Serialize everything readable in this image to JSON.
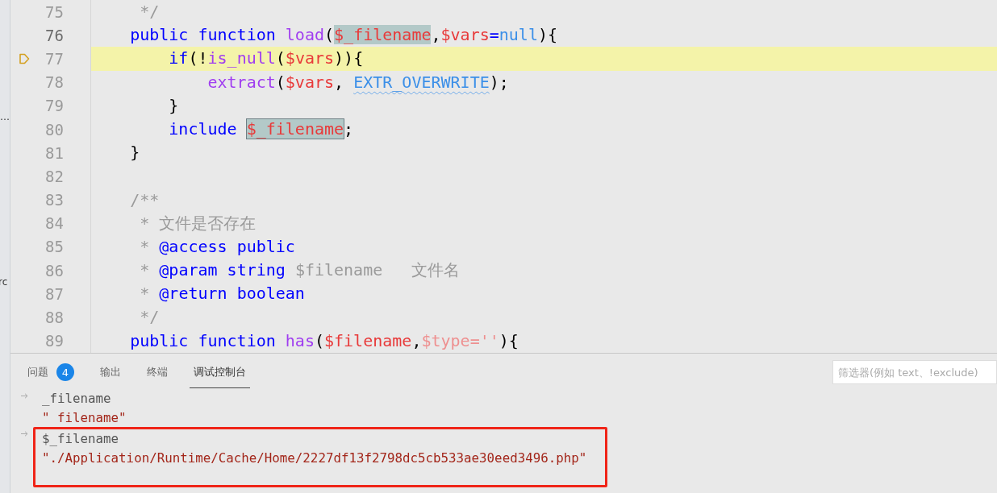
{
  "sidebar": {
    "fragments": [
      "…",
      "rc"
    ]
  },
  "editor": {
    "lines": [
      {
        "number": "75",
        "current": false,
        "highlighted": false,
        "breakpoint": false,
        "tokens": [
          {
            "t": "     */",
            "kind": "comment"
          }
        ]
      },
      {
        "number": "76",
        "current": true,
        "highlighted": false,
        "breakpoint": false,
        "tokens": [
          {
            "t": "    public function ",
            "kind": "keyword"
          },
          {
            "t": "load",
            "kind": "function"
          },
          {
            "t": "(",
            "kind": "punct"
          },
          {
            "t": "$_filename",
            "kind": "match"
          },
          {
            "t": ",",
            "kind": "punct"
          },
          {
            "t": "$vars",
            "kind": "variable"
          },
          {
            "t": "=",
            "kind": "keyword"
          },
          {
            "t": "null",
            "kind": "constant"
          },
          {
            "t": "){",
            "kind": "punct"
          }
        ]
      },
      {
        "number": "77",
        "current": false,
        "highlighted": true,
        "breakpoint": true,
        "tokens": [
          {
            "t": "        if",
            "kind": "keyword"
          },
          {
            "t": "(!",
            "kind": "punct"
          },
          {
            "t": "is_null",
            "kind": "function"
          },
          {
            "t": "(",
            "kind": "punct"
          },
          {
            "t": "$vars",
            "kind": "variable"
          },
          {
            "t": ")){",
            "kind": "punct"
          }
        ]
      },
      {
        "number": "78",
        "current": false,
        "highlighted": false,
        "breakpoint": false,
        "tokens": [
          {
            "t": "            extract",
            "kind": "function"
          },
          {
            "t": "(",
            "kind": "punct"
          },
          {
            "t": "$vars",
            "kind": "variable"
          },
          {
            "t": ", ",
            "kind": "punct"
          },
          {
            "t": "EXTR_OVERWRITE",
            "kind": "constant-warn"
          },
          {
            "t": ");",
            "kind": "punct"
          }
        ]
      },
      {
        "number": "79",
        "current": false,
        "highlighted": false,
        "breakpoint": false,
        "tokens": [
          {
            "t": "        }",
            "kind": "punct"
          }
        ]
      },
      {
        "number": "80",
        "current": false,
        "highlighted": false,
        "breakpoint": false,
        "tokens": [
          {
            "t": "        include ",
            "kind": "keyword"
          },
          {
            "t": "$_filename",
            "kind": "match-box"
          },
          {
            "t": ";",
            "kind": "punct"
          }
        ]
      },
      {
        "number": "81",
        "current": false,
        "highlighted": false,
        "breakpoint": false,
        "tokens": [
          {
            "t": "    }",
            "kind": "punct"
          }
        ]
      },
      {
        "number": "82",
        "current": false,
        "breakpoint": false
      },
      {
        "number": "83",
        "current": false,
        "highlighted": false,
        "breakpoint": false,
        "tokens": [
          {
            "t": "    /**",
            "kind": "comment"
          }
        ]
      },
      {
        "number": "84",
        "current": false,
        "highlighted": false,
        "breakpoint": false,
        "tokens": [
          {
            "t": "     * 文件是否存在",
            "kind": "comment"
          }
        ]
      },
      {
        "number": "85",
        "current": false,
        "highlighted": false,
        "breakpoint": false,
        "tokens": [
          {
            "t": "     * ",
            "kind": "comment"
          },
          {
            "t": "@access public",
            "kind": "doctag"
          }
        ]
      },
      {
        "number": "86",
        "current": false,
        "highlighted": false,
        "breakpoint": false,
        "tokens": [
          {
            "t": "     * ",
            "kind": "comment"
          },
          {
            "t": "@param string ",
            "kind": "doctag"
          },
          {
            "t": "$filename   文件名",
            "kind": "comment"
          }
        ]
      },
      {
        "number": "87",
        "current": false,
        "highlighted": false,
        "breakpoint": false,
        "tokens": [
          {
            "t": "     * ",
            "kind": "comment"
          },
          {
            "t": "@return boolean",
            "kind": "doctag"
          }
        ]
      },
      {
        "number": "88",
        "current": false,
        "highlighted": false,
        "breakpoint": false,
        "tokens": [
          {
            "t": "     */",
            "kind": "comment"
          }
        ]
      },
      {
        "number": "89",
        "current": false,
        "highlighted": false,
        "breakpoint": false,
        "tokens": [
          {
            "t": "    public function ",
            "kind": "keyword"
          },
          {
            "t": "has",
            "kind": "function"
          },
          {
            "t": "(",
            "kind": "punct"
          },
          {
            "t": "$filename",
            "kind": "variable"
          },
          {
            "t": ",",
            "kind": "punct"
          },
          {
            "t": "$type=''",
            "kind": "faded"
          },
          {
            "t": "){",
            "kind": "punct"
          }
        ]
      }
    ]
  },
  "panel": {
    "tabs": [
      {
        "label": "问题",
        "badge": "4",
        "selected": false
      },
      {
        "label": "输出",
        "selected": false
      },
      {
        "label": "终端",
        "selected": false
      },
      {
        "label": "调试控制台",
        "selected": true
      }
    ],
    "filter": {
      "placeholder": "筛选器(例如 text、!exclude)"
    },
    "console": [
      {
        "expression": "_filename",
        "value": "\" filename\"",
        "highlighted": false
      },
      {
        "expression": "$_filename",
        "value": "\"./Application/Runtime/Cache/Home/2227df13f2798dc5cb533ae30eed3496.php\"",
        "highlighted": true
      }
    ]
  }
}
